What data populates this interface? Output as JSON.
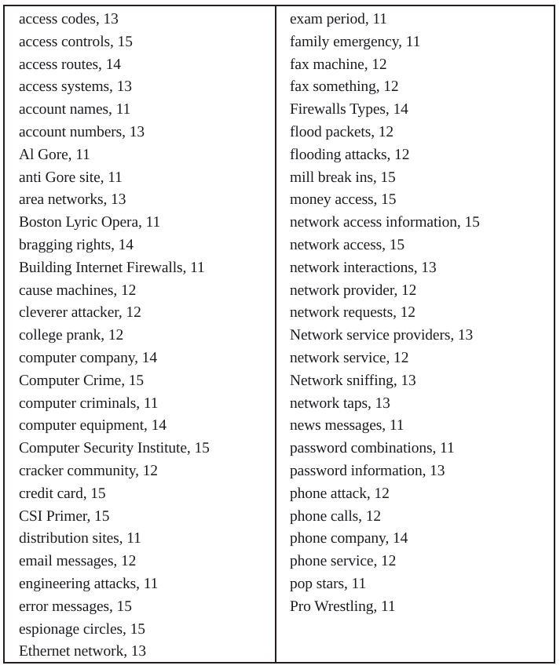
{
  "document": {
    "type": "two-column-term-frequency-table",
    "separator": ", ",
    "border_color": "#231f20",
    "text_color": "#1b1b1f",
    "background_color": "#ffffff"
  },
  "columns": [
    {
      "name": "left-column",
      "entries": [
        {
          "term": "access codes",
          "count": 13,
          "text": "access codes, 13"
        },
        {
          "term": "access controls",
          "count": 15,
          "text": "access controls, 15"
        },
        {
          "term": "access routes",
          "count": 14,
          "text": "access routes, 14"
        },
        {
          "term": "access systems",
          "count": 13,
          "text": "access systems, 13"
        },
        {
          "term": "account names",
          "count": 11,
          "text": "account names, 11"
        },
        {
          "term": "account numbers",
          "count": 13,
          "text": "account numbers, 13"
        },
        {
          "term": "Al Gore",
          "count": 11,
          "text": "Al Gore, 11"
        },
        {
          "term": "anti Gore site",
          "count": 11,
          "text": "anti Gore site, 11"
        },
        {
          "term": "area networks",
          "count": 13,
          "text": "area networks, 13"
        },
        {
          "term": "Boston Lyric Opera",
          "count": 11,
          "text": "Boston Lyric Opera, 11"
        },
        {
          "term": "bragging rights",
          "count": 14,
          "text": "bragging rights, 14"
        },
        {
          "term": "Building Internet Firewalls",
          "count": 11,
          "text": "Building Internet Firewalls, 11"
        },
        {
          "term": "cause machines",
          "count": 12,
          "text": "cause machines, 12"
        },
        {
          "term": "cleverer attacker",
          "count": 12,
          "text": "cleverer attacker, 12"
        },
        {
          "term": "college prank",
          "count": 12,
          "text": "college prank, 12"
        },
        {
          "term": "computer company",
          "count": 14,
          "text": "computer company, 14"
        },
        {
          "term": "Computer Crime",
          "count": 15,
          "text": "Computer Crime, 15"
        },
        {
          "term": "computer criminals",
          "count": 11,
          "text": "computer criminals, 11"
        },
        {
          "term": "computer equipment",
          "count": 14,
          "text": "computer equipment, 14"
        },
        {
          "term": "Computer Security Institute",
          "count": 15,
          "text": "Computer Security Institute, 15"
        },
        {
          "term": "cracker community",
          "count": 12,
          "text": "cracker community, 12"
        },
        {
          "term": "credit card",
          "count": 15,
          "text": "credit card, 15"
        },
        {
          "term": "CSI Primer",
          "count": 15,
          "text": "CSI Primer, 15"
        },
        {
          "term": "distribution sites",
          "count": 11,
          "text": "distribution sites, 11"
        },
        {
          "term": "email messages",
          "count": 12,
          "text": "email messages, 12"
        },
        {
          "term": "engineering attacks",
          "count": 11,
          "text": "engineering attacks, 11"
        },
        {
          "term": "error messages",
          "count": 15,
          "text": "error messages, 15"
        },
        {
          "term": "espionage circles",
          "count": 15,
          "text": "espionage circles, 15"
        },
        {
          "term": "Ethernet network",
          "count": 13,
          "text": "Ethernet network, 13"
        }
      ]
    },
    {
      "name": "right-column",
      "entries": [
        {
          "term": "exam period",
          "count": 11,
          "text": "exam period, 11"
        },
        {
          "term": "family emergency",
          "count": 11,
          "text": "family emergency, 11"
        },
        {
          "term": "fax machine",
          "count": 12,
          "text": "fax machine, 12"
        },
        {
          "term": "fax something",
          "count": 12,
          "text": "fax something, 12"
        },
        {
          "term": "Firewalls Types",
          "count": 14,
          "text": "Firewalls Types, 14"
        },
        {
          "term": "flood packets",
          "count": 12,
          "text": "flood packets, 12"
        },
        {
          "term": "flooding attacks",
          "count": 12,
          "text": "flooding attacks, 12"
        },
        {
          "term": "mill break ins",
          "count": 15,
          "text": "mill break ins, 15"
        },
        {
          "term": "money access",
          "count": 15,
          "text": "money access, 15"
        },
        {
          "term": "network access information",
          "count": 15,
          "text": "network access information, 15"
        },
        {
          "term": "network access",
          "count": 15,
          "text": "network access, 15"
        },
        {
          "term": "network interactions",
          "count": 13,
          "text": "network interactions, 13"
        },
        {
          "term": "network provider",
          "count": 12,
          "text": "network provider, 12"
        },
        {
          "term": "network requests",
          "count": 12,
          "text": "network requests, 12"
        },
        {
          "term": "Network service providers",
          "count": 13,
          "text": "Network service providers, 13"
        },
        {
          "term": "network service",
          "count": 12,
          "text": "network service, 12"
        },
        {
          "term": "Network sniffing",
          "count": 13,
          "text": "Network sniffing, 13"
        },
        {
          "term": "network taps",
          "count": 13,
          "text": "network taps, 13"
        },
        {
          "term": "news messages",
          "count": 11,
          "text": "news messages, 11"
        },
        {
          "term": "password combinations",
          "count": 11,
          "text": "password combinations, 11"
        },
        {
          "term": "password information",
          "count": 13,
          "text": "password information, 13"
        },
        {
          "term": "phone attack",
          "count": 12,
          "text": "phone attack, 12"
        },
        {
          "term": "phone calls",
          "count": 12,
          "text": "phone calls, 12"
        },
        {
          "term": "phone company",
          "count": 14,
          "text": "phone company, 14"
        },
        {
          "term": "phone service",
          "count": 12,
          "text": "phone service, 12"
        },
        {
          "term": "pop stars",
          "count": 11,
          "text": "pop stars, 11"
        },
        {
          "term": "Pro Wrestling",
          "count": 11,
          "text": "Pro Wrestling, 11"
        }
      ]
    }
  ]
}
